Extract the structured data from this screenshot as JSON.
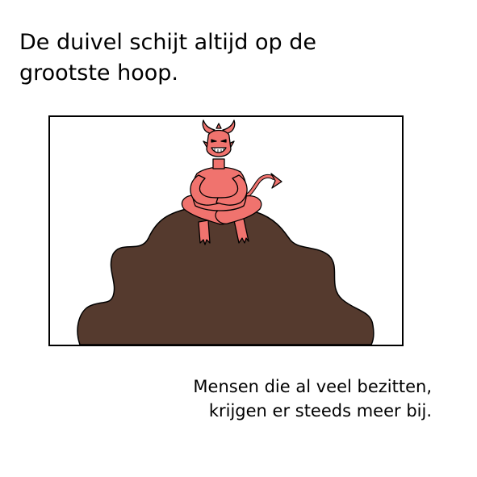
{
  "title_lines": [
    "De duivel schijt altijd op de",
    "grootste hoop."
  ],
  "caption_lines": [
    "Mensen die al veel bezitten,",
    "krijgen er steeds meer bij."
  ],
  "colors": {
    "background": "#ffffff",
    "outline": "#000000",
    "devil_skin": "#f0736e",
    "devil_shade": "#d85a56",
    "pile": "#553a2e"
  },
  "illustration": {
    "subject": "devil-sitting-on-pile",
    "elements": [
      "devil-icon",
      "horns-icon",
      "tail-icon",
      "pile-icon"
    ]
  }
}
